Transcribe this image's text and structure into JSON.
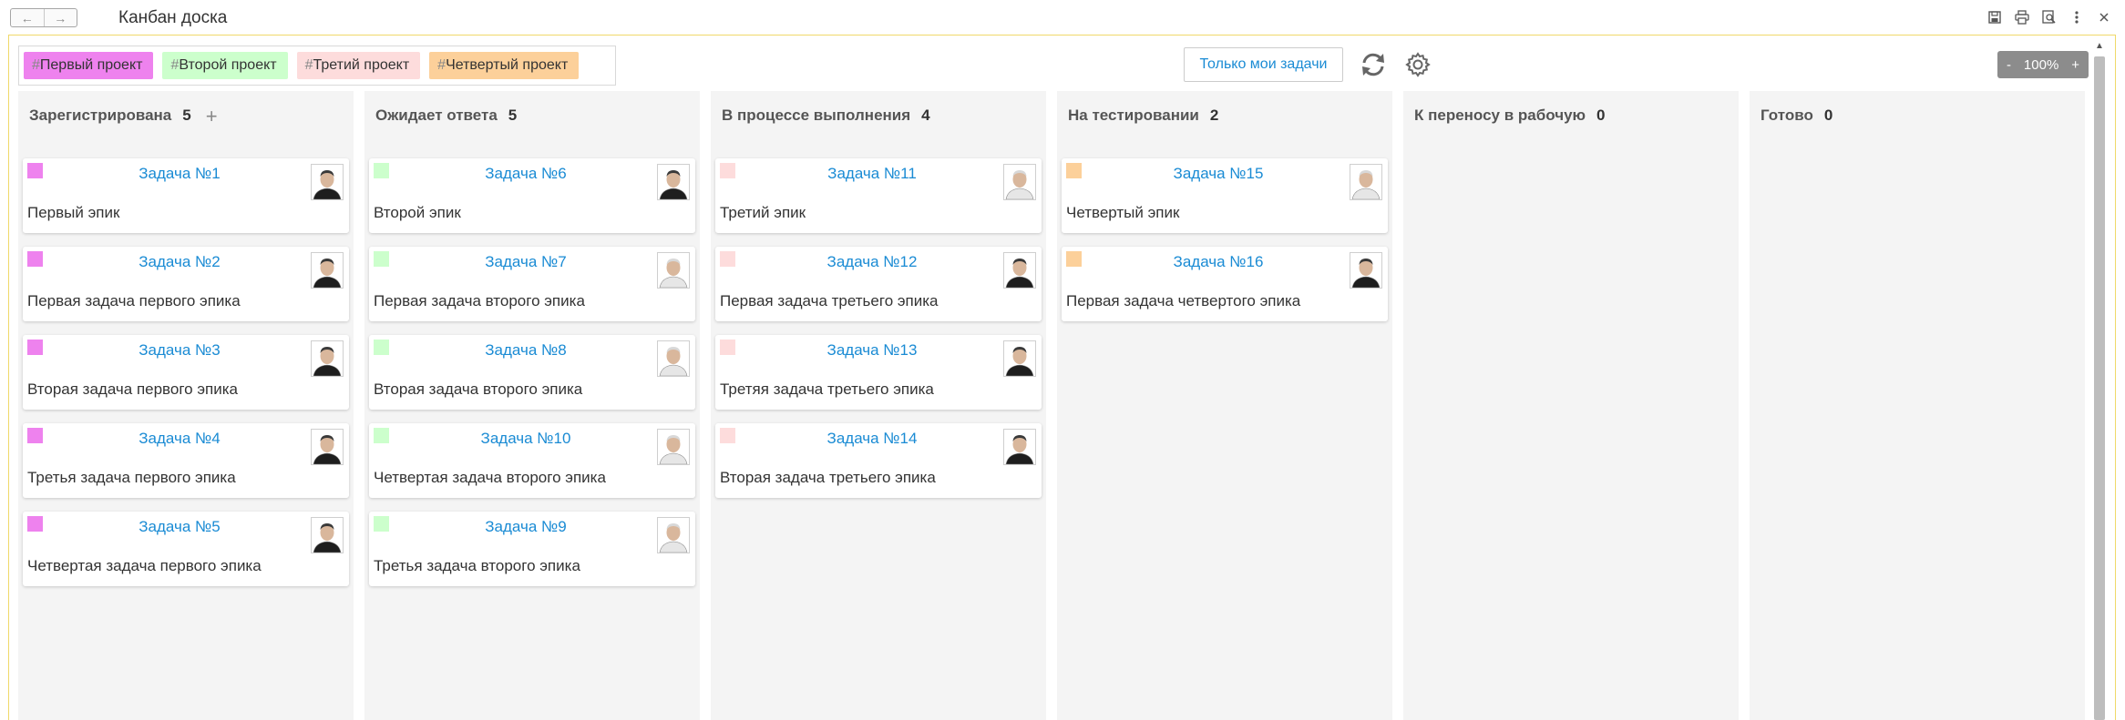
{
  "window": {
    "title": "Канбан доска"
  },
  "toolbar": {
    "hash": "#",
    "projects": [
      {
        "label": "Первый проект",
        "color": "#ee82ee"
      },
      {
        "label": "Второй проект",
        "color": "#ccffcc"
      },
      {
        "label": "Третий проект",
        "color": "#fddcdc"
      },
      {
        "label": "Четвертый проект",
        "color": "#fcd09a"
      }
    ],
    "my_tasks_label": "Только мои задачи",
    "zoom": {
      "minus": "-",
      "value": "100%",
      "plus": "+"
    }
  },
  "columns": [
    {
      "title": "Зарегистрирована",
      "count": "5",
      "add": "+",
      "cards": [
        {
          "title": "Задача №1",
          "desc": "Первый эпик",
          "color": "#ee82ee",
          "avatar": "dark"
        },
        {
          "title": "Задача №2",
          "desc": "Первая задача первого эпика",
          "color": "#ee82ee",
          "avatar": "dark"
        },
        {
          "title": "Задача №3",
          "desc": "Вторая задача первого эпика",
          "color": "#ee82ee",
          "avatar": "dark"
        },
        {
          "title": "Задача №4",
          "desc": "Третья задача первого эпика",
          "color": "#ee82ee",
          "avatar": "dark"
        },
        {
          "title": "Задача №5",
          "desc": "Четвертая задача первого эпика",
          "color": "#ee82ee",
          "avatar": "dark"
        }
      ]
    },
    {
      "title": "Ожидает ответа",
      "count": "5",
      "cards": [
        {
          "title": "Задача №6",
          "desc": "Второй эпик",
          "color": "#ccffcc",
          "avatar": "dark"
        },
        {
          "title": "Задача №7",
          "desc": "Первая задача второго эпика",
          "color": "#ccffcc",
          "avatar": "light"
        },
        {
          "title": "Задача №8",
          "desc": "Вторая задача второго эпика",
          "color": "#ccffcc",
          "avatar": "light"
        },
        {
          "title": "Задача №10",
          "desc": "Четвертая задача второго эпика",
          "color": "#ccffcc",
          "avatar": "light"
        },
        {
          "title": "Задача №9",
          "desc": "Третья задача второго эпика",
          "color": "#ccffcc",
          "avatar": "light"
        }
      ]
    },
    {
      "title": "В процессе выполнения",
      "count": "4",
      "cards": [
        {
          "title": "Задача №11",
          "desc": "Третий эпик",
          "color": "#fddcdc",
          "avatar": "light"
        },
        {
          "title": "Задача №12",
          "desc": "Первая задача третьего эпика",
          "color": "#fddcdc",
          "avatar": "dark"
        },
        {
          "title": "Задача №13",
          "desc": "Третяя задача третьего эпика",
          "color": "#fddcdc",
          "avatar": "dark"
        },
        {
          "title": "Задача №14",
          "desc": "Вторая задача третьего эпика",
          "color": "#fddcdc",
          "avatar": "dark"
        }
      ]
    },
    {
      "title": "На тестировании",
      "count": "2",
      "cards": [
        {
          "title": "Задача №15",
          "desc": "Четвертый эпик",
          "color": "#fcd09a",
          "avatar": "light"
        },
        {
          "title": "Задача №16",
          "desc": "Первая задача четвертого эпика",
          "color": "#fcd09a",
          "avatar": "dark"
        }
      ]
    },
    {
      "title": "К переносу в рабочую",
      "count": "0",
      "cards": []
    },
    {
      "title": "Готово",
      "count": "0",
      "cards": []
    }
  ]
}
